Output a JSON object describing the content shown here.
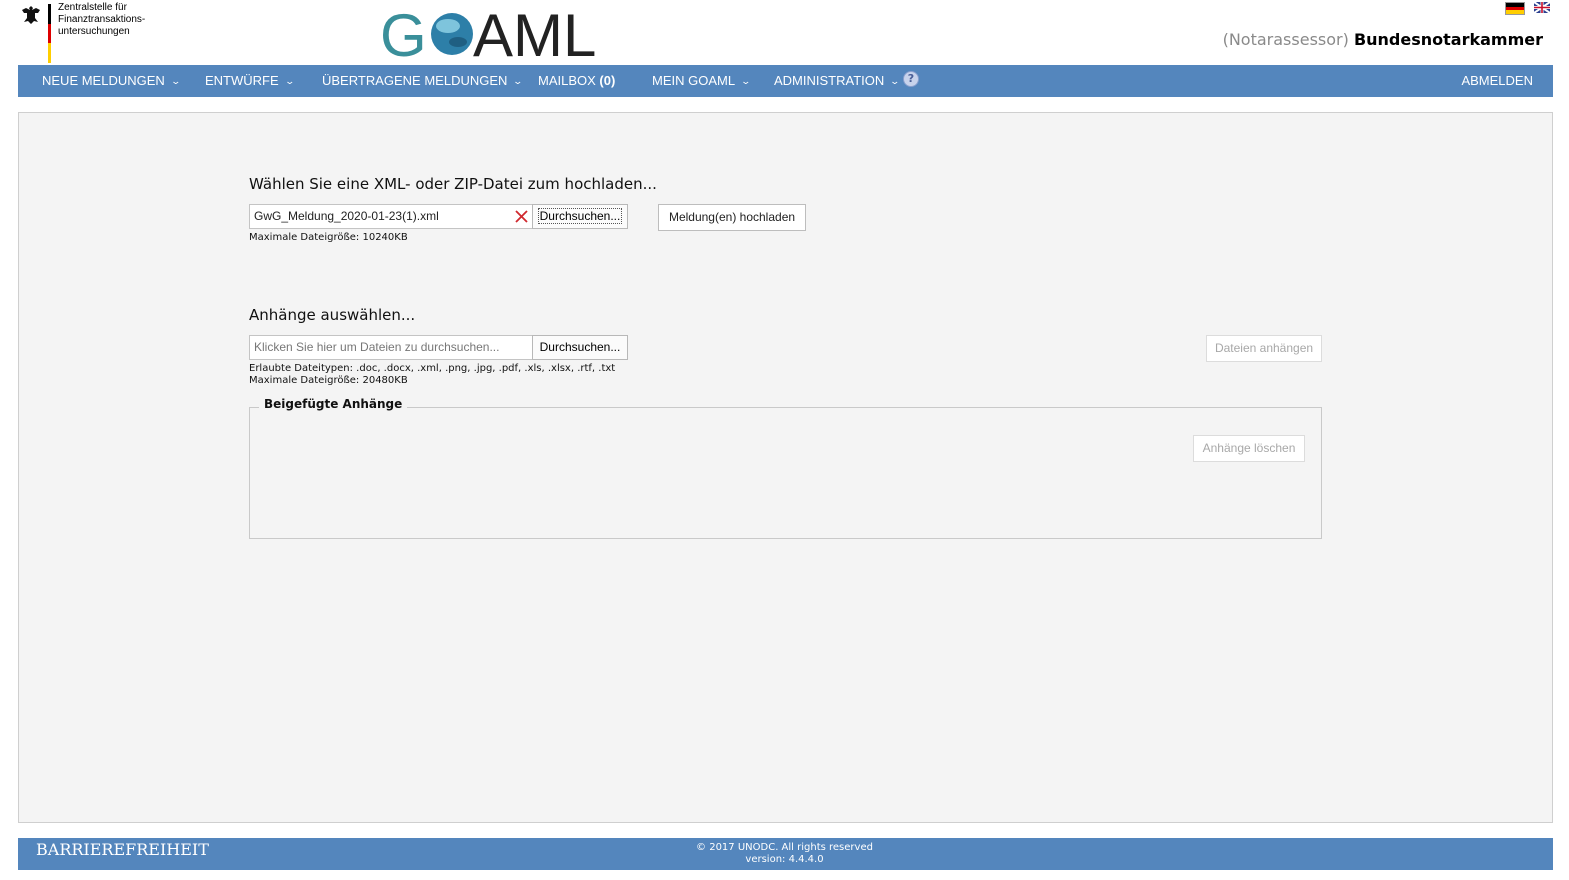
{
  "header": {
    "agency_line1": "Zentralstelle für",
    "agency_line2": "Finanztransaktions-",
    "agency_line3": "untersuchungen",
    "logo_text": "GOAML",
    "role": "(Notarassessor)",
    "organization": "Bundesnotarkammer",
    "languages": [
      "de-flag-icon",
      "en-flag-icon"
    ]
  },
  "nav": {
    "items": [
      {
        "label": "NEUE MELDUNGEN"
      },
      {
        "label": "ENTWÜRFE"
      },
      {
        "label": "ÜBERTRAGENE MELDUNGEN"
      },
      {
        "label": "MAILBOX",
        "count": "(0)"
      },
      {
        "label": "MEIN GOAML"
      },
      {
        "label": "ADMINISTRATION"
      }
    ],
    "help": "?",
    "logout": "ABMELDEN"
  },
  "upload": {
    "heading": "Wählen Sie eine XML- oder ZIP-Datei zum hochladen...",
    "file_value": "GwG_Meldung_2020-01-23(1).xml",
    "browse_label": "Durchsuchen...",
    "submit_label": "Meldung(en) hochladen",
    "max_size": "Maximale Dateigröße: 10240KB"
  },
  "attachments": {
    "heading": "Anhänge auswählen...",
    "placeholder": "Klicken Sie hier um Dateien zu durchsuchen...",
    "browse_label": "Durchsuchen...",
    "attach_label": "Dateien anhängen",
    "allowed_types": "Erlaubte Dateitypen: .doc, .docx, .xml, .png, .jpg, .pdf, .xls, .xlsx, .rtf, .txt",
    "max_size": "Maximale Dateigröße: 20480KB",
    "attached_legend": "Beigefügte Anhänge",
    "delete_label": "Anhänge löschen"
  },
  "footer": {
    "accessibility": "BARRIEREFREIHEIT",
    "copyright": "© 2017 UNODC. All rights reserved",
    "version": "version: 4.4.4.0"
  },
  "colors": {
    "nav_bg": "#5486bd",
    "panel_bg": "#f4f4f4",
    "role_gray": "#8a8a8a",
    "logo_teal": "#3a8f9a"
  }
}
